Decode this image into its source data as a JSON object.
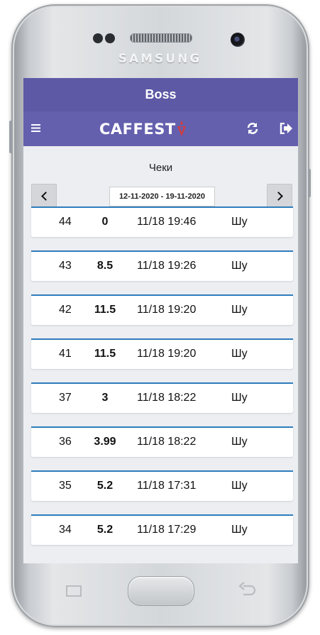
{
  "device": {
    "brand": "SAMSUNG"
  },
  "app": {
    "title": "Boss",
    "logo_text": "CAFFEST",
    "section_title": "Чеки",
    "date_range": "12-11-2020 - 19-11-2020"
  },
  "colors": {
    "header": "#5d59a5",
    "toolbar": "#6460ae",
    "row_accent": "#2e7dbc",
    "logo_mark": "#d53b3b"
  },
  "receipts": [
    {
      "id": "44",
      "amount": "0",
      "time": "11/18 19:46",
      "user": "Шу"
    },
    {
      "id": "43",
      "amount": "8.5",
      "time": "11/18 19:26",
      "user": "Шу"
    },
    {
      "id": "42",
      "amount": "11.5",
      "time": "11/18 19:20",
      "user": "Шу"
    },
    {
      "id": "41",
      "amount": "11.5",
      "time": "11/18 19:20",
      "user": "Шу"
    },
    {
      "id": "37",
      "amount": "3",
      "time": "11/18 18:22",
      "user": "Шу"
    },
    {
      "id": "36",
      "amount": "3.99",
      "time": "11/18 18:22",
      "user": "Шу"
    },
    {
      "id": "35",
      "amount": "5.2",
      "time": "11/18 17:31",
      "user": "Шу"
    },
    {
      "id": "34",
      "amount": "5.2",
      "time": "11/18 17:29",
      "user": "Шу"
    }
  ]
}
